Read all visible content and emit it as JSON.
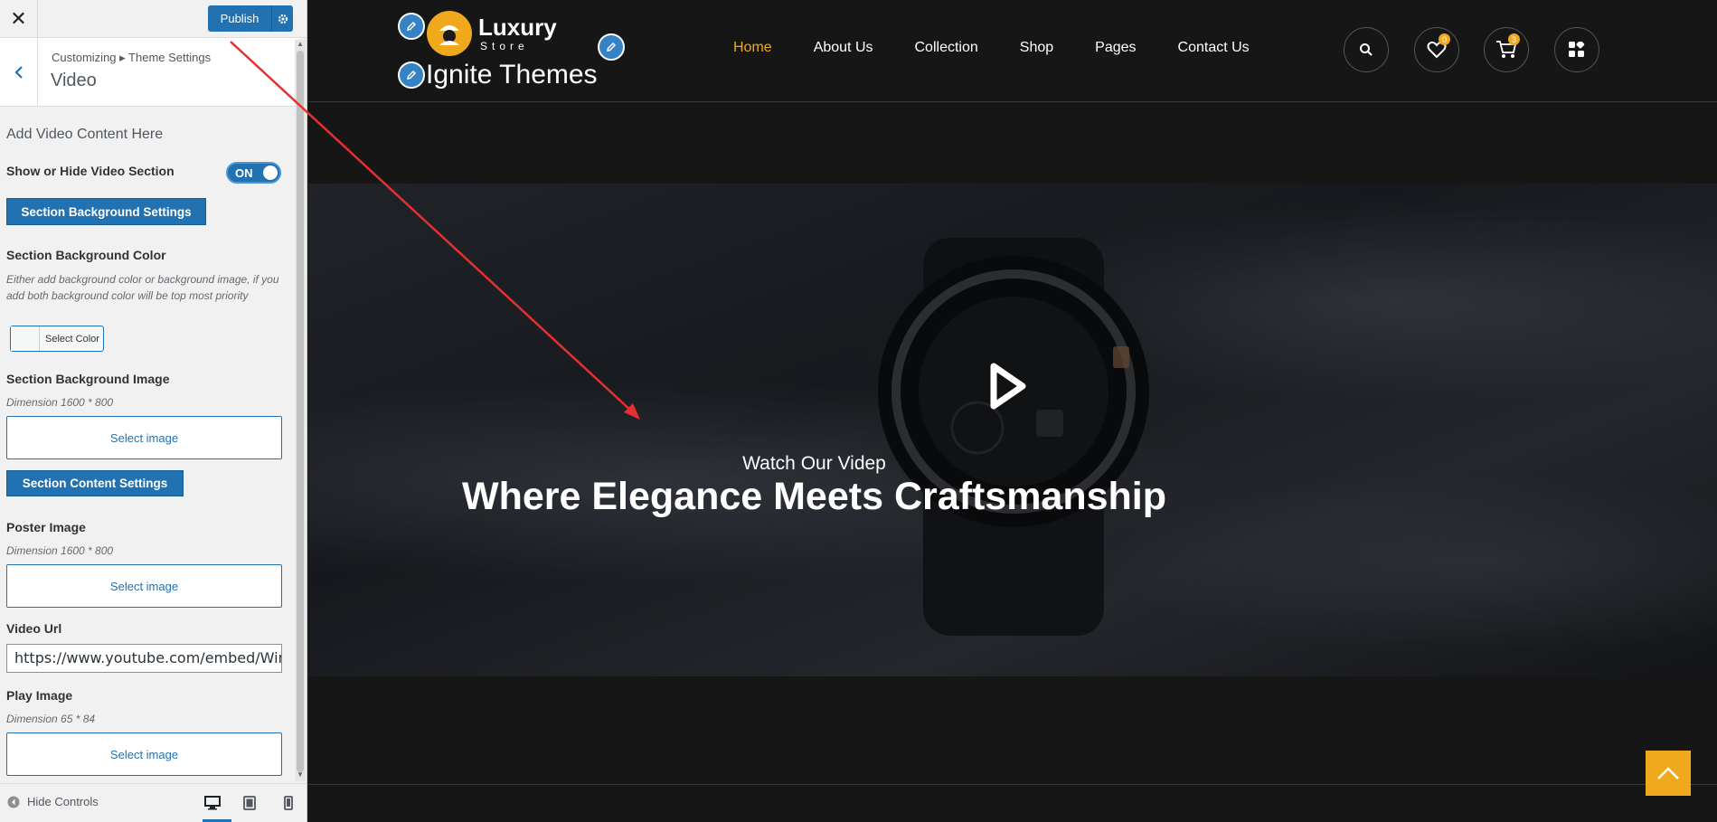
{
  "customizer": {
    "publish_label": "Publish",
    "breadcrumb": "Customizing ▸ Theme Settings",
    "section_title": "Video",
    "heading": "Add Video Content Here",
    "show_hide_label": "Show or Hide Video Section",
    "toggle_state": "ON",
    "bg_settings_button": "Section Background Settings",
    "bg_color_label": "Section Background Color",
    "bg_color_desc": "Either add background color or background image, if you add both background color will be top most priority",
    "select_color_label": "Select Color",
    "bg_image_label": "Section Background Image",
    "bg_image_dim": "Dimension 1600 * 800",
    "select_image": "Select image",
    "content_settings_button": "Section Content Settings",
    "poster_label": "Poster Image",
    "poster_dim": "Dimension 1600 * 800",
    "video_url_label": "Video Url",
    "video_url_value": "https://www.youtube.com/embed/Wimb",
    "play_image_label": "Play Image",
    "play_image_dim": "Dimension 65 * 84",
    "hide_controls": "Hide Controls",
    "accent_color": "#2271b1"
  },
  "site": {
    "logo_word": "Luxury",
    "logo_sub": "Store",
    "site_title": "Ignite Themes",
    "nav": [
      "Home",
      "About Us",
      "Collection",
      "Shop",
      "Pages",
      "Contact Us"
    ],
    "active_nav": "Home",
    "wishlist_count": "0",
    "cart_count": "3",
    "hero_subtitle": "Watch Our Videp",
    "hero_title": "Where Elegance Meets Craftsmanship",
    "accent_color": "#f0a91c",
    "icons": [
      "search-icon",
      "heart-icon",
      "cart-icon",
      "grid-icon",
      "play-icon",
      "chevron-up-icon"
    ]
  }
}
